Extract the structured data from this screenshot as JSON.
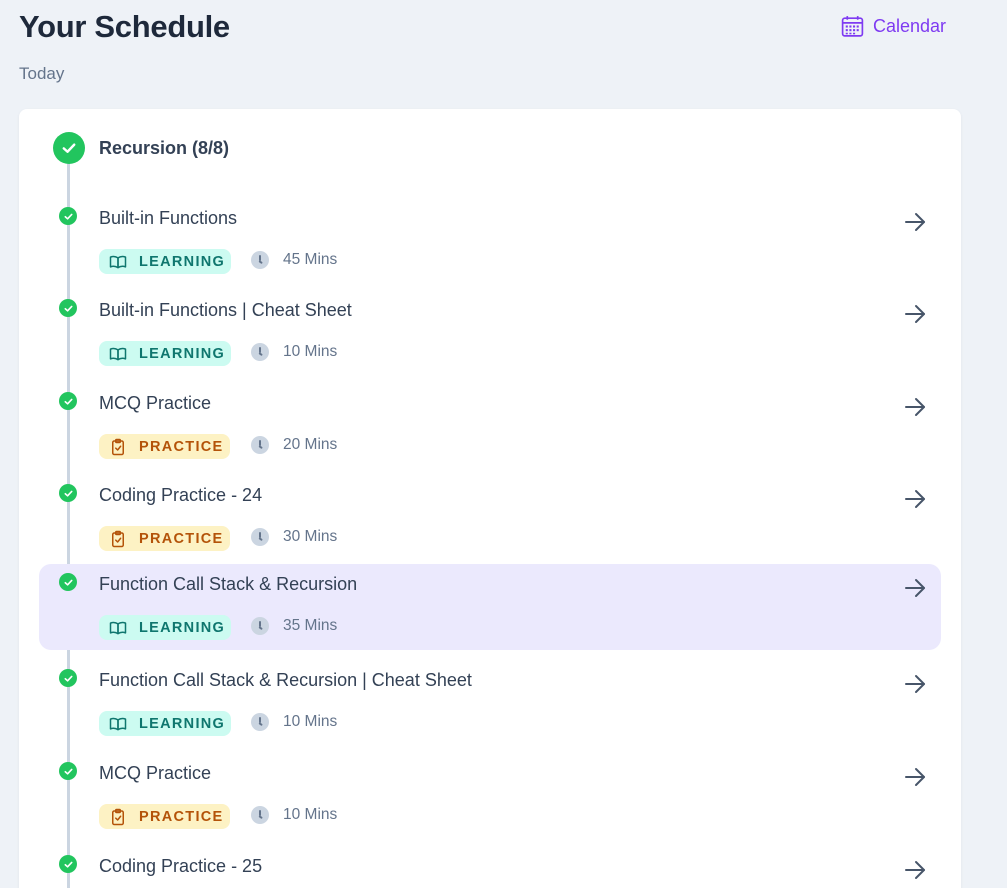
{
  "header": {
    "title": "Your Schedule",
    "subtitle": "Today",
    "calendar_label": "Calendar",
    "calendar_icon": "calendar-icon"
  },
  "module": {
    "title": "Recursion (8/8)",
    "status": "completed"
  },
  "colors": {
    "accent": "#7e3af2",
    "success": "#22c55e",
    "learning_bg": "#ccfbf1",
    "learning_text": "#0f766e",
    "practice_bg": "#fdf2c4",
    "practice_text": "#b45309",
    "active_row": "#ebe9fd"
  },
  "items": [
    {
      "title": "Built-in Functions",
      "type": "LEARNING",
      "duration": "45 Mins",
      "status": "completed",
      "active": false
    },
    {
      "title": "Built-in Functions | Cheat Sheet",
      "type": "LEARNING",
      "duration": "10 Mins",
      "status": "completed",
      "active": false
    },
    {
      "title": "MCQ Practice",
      "type": "PRACTICE",
      "duration": "20 Mins",
      "status": "completed",
      "active": false
    },
    {
      "title": "Coding Practice - 24",
      "type": "PRACTICE",
      "duration": "30 Mins",
      "status": "completed",
      "active": false
    },
    {
      "title": "Function Call Stack & Recursion",
      "type": "LEARNING",
      "duration": "35 Mins",
      "status": "completed",
      "active": true
    },
    {
      "title": "Function Call Stack & Recursion | Cheat Sheet",
      "type": "LEARNING",
      "duration": "10 Mins",
      "status": "completed",
      "active": false
    },
    {
      "title": "MCQ Practice",
      "type": "PRACTICE",
      "duration": "10 Mins",
      "status": "completed",
      "active": false
    },
    {
      "title": "Coding Practice - 25",
      "type": "",
      "duration": "",
      "status": "completed",
      "active": false
    }
  ]
}
